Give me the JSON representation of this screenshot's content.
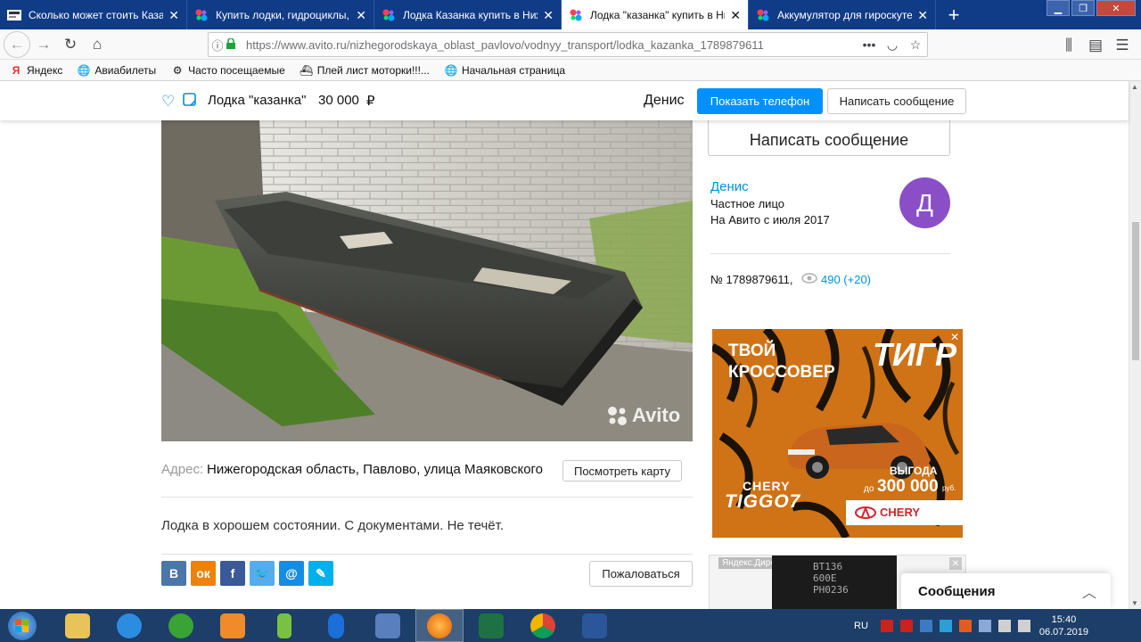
{
  "tabs": [
    {
      "title": "Сколько может стоить Казанк",
      "active": false
    },
    {
      "title": "Купить лодки, гидроциклы, ка",
      "active": false
    },
    {
      "title": "Лодка Казанка купить в Нижег",
      "active": false
    },
    {
      "title": "Лодка \"казанка\" купить в Ниж",
      "active": true
    },
    {
      "title": "Аккумулятор для гироскутера",
      "active": false
    }
  ],
  "url": "https://www.avito.ru/nizhegorodskaya_oblast_pavlovo/vodnyy_transport/lodka_kazanka_1789879611",
  "bookmarks": [
    "Яндекс",
    "Авиабилеты",
    "Часто посещаемые",
    "Плей лист моторки!!!...",
    "Начальная страница"
  ],
  "header": {
    "title": "Лодка \"казанка\"",
    "price": "30 000",
    "currency": "₽",
    "seller": "Денис",
    "show_phone": "Показать телефон",
    "write_message": "Написать сообщение"
  },
  "sidebar": {
    "write_message": "Написать сообщение",
    "seller_name": "Денис",
    "seller_type": "Частное лицо",
    "since": "На Авито с июля 2017",
    "avatar_letter": "Д",
    "item_no": "№ 1789879611,",
    "views": "490 (+20)"
  },
  "ad": {
    "line1": "ТВОЙ",
    "line2": "КРОССОВЕР",
    "brand_big": "ТИГР",
    "profit": "ВЫГОДА",
    "profit_prefix": "до",
    "profit_value": "300 000",
    "profit_unit": "руб.",
    "model1": "CHERY",
    "model2": "TIGGO7",
    "logo": "CHERY",
    "close": "✕",
    "direct_label": "Яндекс.Директ",
    "chip_text": "BT136\n600E\nPH0236"
  },
  "listing": {
    "watermark": "Avito",
    "address_label": "Адрес:",
    "address": "Нижегородская область, Павлово, улица Маяковского",
    "map_button": "Посмотреть карту",
    "description": "Лодка в хорошем состоянии. С документами. Не течёт.",
    "complain": "Пожаловаться"
  },
  "messages_panel": {
    "title": "Сообщения"
  },
  "taskbar": {
    "lang": "RU",
    "time": "15:40",
    "date": "06.07.2019"
  },
  "colors": {
    "avito_blue": "#0091ff",
    "link_blue": "#0091d9",
    "avatar": "#8a4fc7",
    "titlebar": "#103b87",
    "taskbar": "#1c3e68"
  }
}
